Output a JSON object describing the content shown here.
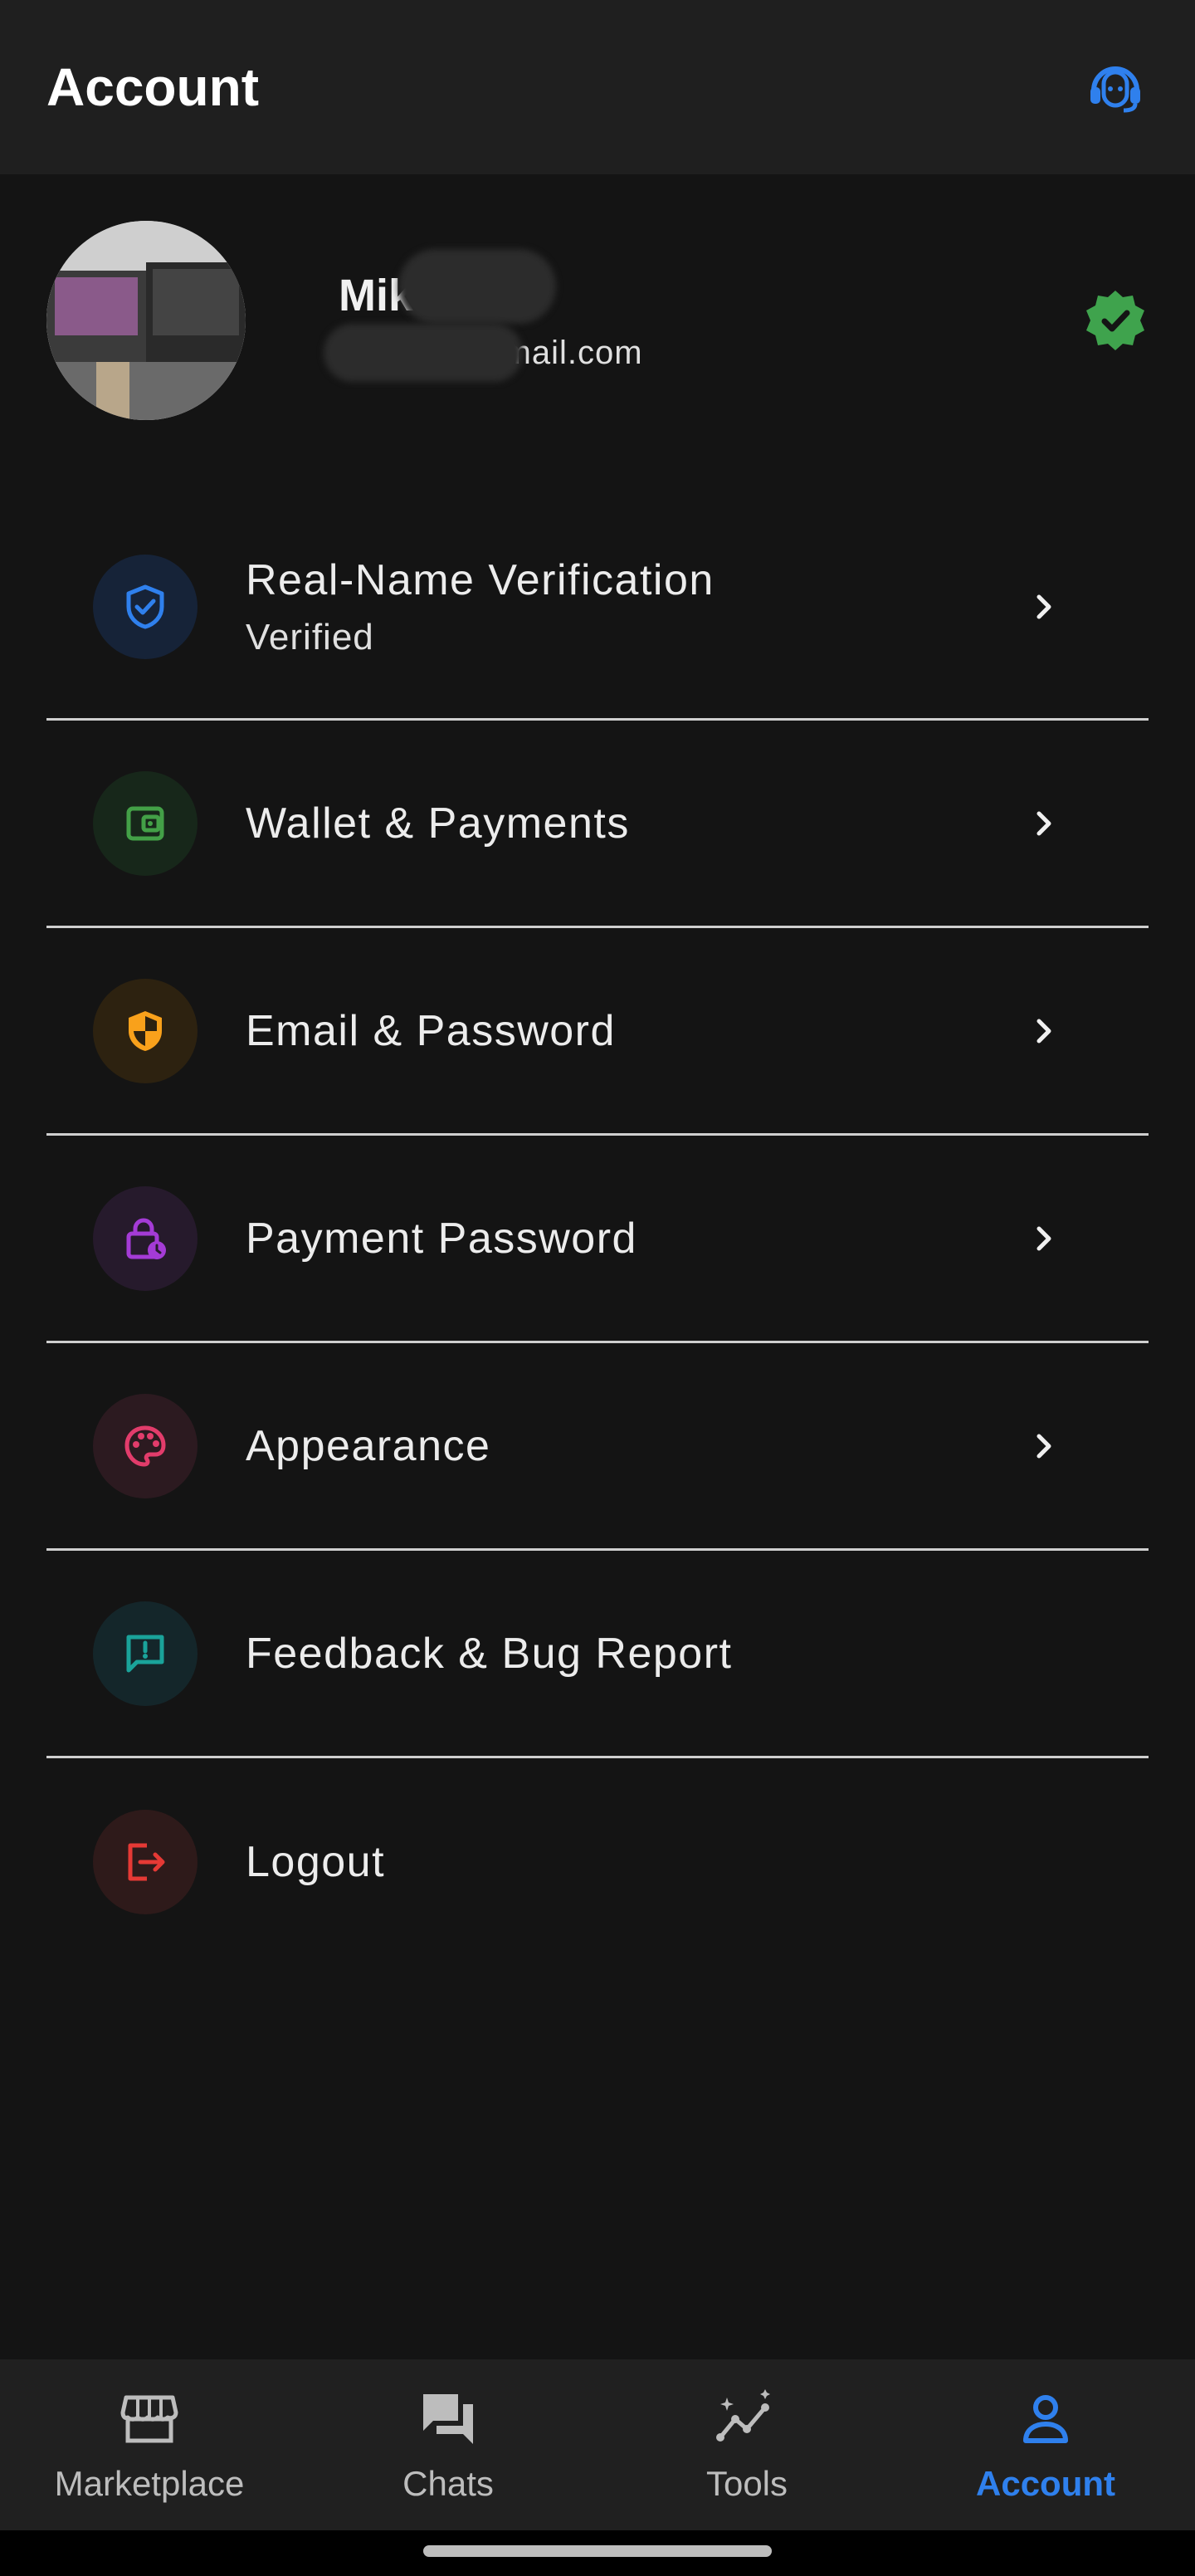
{
  "appbar": {
    "title": "Account",
    "support_icon": "headset-support-icon",
    "accent": "#2f80ed"
  },
  "profile": {
    "name": "Mike",
    "email": "mikej        o@gmail.com",
    "badge_icon": "verified-check-badge-icon",
    "badge_color": "#3fa34d"
  },
  "menu": {
    "items": [
      {
        "label": "Real-Name Verification",
        "sub": "Verified",
        "icon": "shield-check-icon",
        "color": "#2f80ed",
        "bg": "#162338"
      },
      {
        "label": "Wallet & Payments",
        "icon": "wallet-icon",
        "color": "#43a047",
        "bg": "#17271a"
      },
      {
        "label": "Email & Password",
        "icon": "shield-half-icon",
        "color": "#f9a11b",
        "bg": "#2d2210"
      },
      {
        "label": "Payment Password",
        "icon": "lock-clock-icon",
        "color": "#a43bd6",
        "bg": "#261a2c"
      },
      {
        "label": "Appearance",
        "icon": "palette-icon",
        "color": "#e23c6b",
        "bg": "#2c1a20"
      },
      {
        "label": "Feedback & Bug Report",
        "icon": "feedback-icon",
        "color": "#1aa39a",
        "bg": "#14262a"
      },
      {
        "label": "Logout",
        "icon": "logout-icon",
        "color": "#e53935",
        "bg": "#2e1a1a"
      }
    ]
  },
  "nav": {
    "items": [
      {
        "label": "Marketplace",
        "icon": "storefront-icon"
      },
      {
        "label": "Chats",
        "icon": "chat-bubbles-icon"
      },
      {
        "label": "Tools",
        "icon": "tools-chart-icon"
      },
      {
        "label": "Account",
        "icon": "person-icon",
        "active": true
      }
    ],
    "active_color": "#2f80ed"
  }
}
